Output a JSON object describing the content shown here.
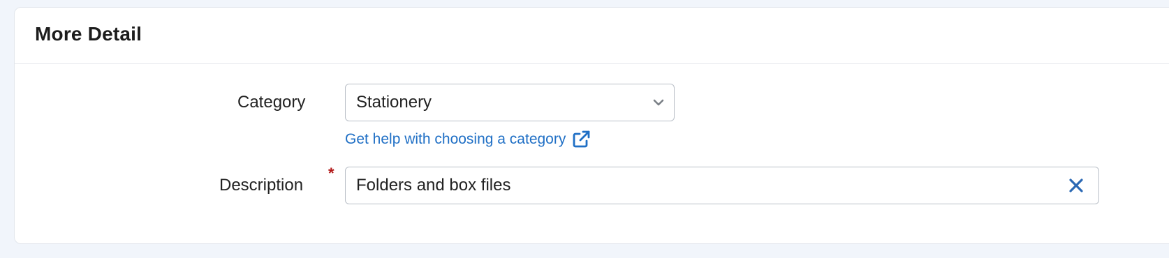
{
  "card": {
    "title": "More Detail"
  },
  "category": {
    "label": "Category",
    "selected_value": "Stationery",
    "dropdown_icon": "chevron-down-icon"
  },
  "help_link": {
    "text": "Get help with choosing a category",
    "icon": "external-link-icon"
  },
  "description": {
    "label": "Description",
    "required_marker": "*",
    "value": "Folders and box files",
    "clear_icon": "close-icon"
  },
  "colors": {
    "page_background": "#f1f5fb",
    "card_background": "#ffffff",
    "link": "#1f6fc5",
    "required": "#b21818",
    "text": "#222222",
    "input_border": "#b9bfc7"
  }
}
